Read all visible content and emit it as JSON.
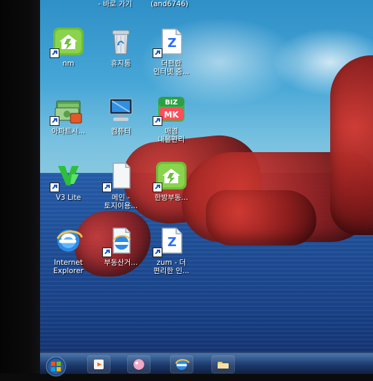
{
  "desktop": {
    "top_fragments": {
      "left": "- 바로 가기",
      "right": "(and6746)"
    },
    "icons": [
      {
        "label": "nm",
        "icon": "green-house-app-icon"
      },
      {
        "label": "휴지통",
        "icon": "recycle-bin-icon"
      },
      {
        "label": "더편한\n인터넷 줌...",
        "icon": "zum-file-icon"
      },
      {
        "label": "아파트시...",
        "icon": "money-notes-icon"
      },
      {
        "label": "컴퓨터",
        "icon": "computer-icon"
      },
      {
        "label": "매경\n내몰관리",
        "icon": "biz-mk-icon"
      },
      {
        "label": "V3 Lite",
        "icon": "v3-lite-icon"
      },
      {
        "label": "메인 -\n토지이용...",
        "icon": "blank-document-icon"
      },
      {
        "label": "한방부동...",
        "icon": "green-house-app-icon"
      },
      {
        "label": "Internet\nExplorer",
        "icon": "internet-explorer-icon"
      },
      {
        "label": "부동산거...",
        "icon": "ie-shortcut-document-icon"
      },
      {
        "label": "zum - 더\n편리한 인...",
        "icon": "zum-file-icon"
      }
    ]
  },
  "taskbar": {
    "items": [
      {
        "name": "start"
      },
      {
        "name": "media-player"
      },
      {
        "name": "app-pink"
      },
      {
        "name": "internet-explorer"
      },
      {
        "name": "file-explorer"
      }
    ]
  }
}
